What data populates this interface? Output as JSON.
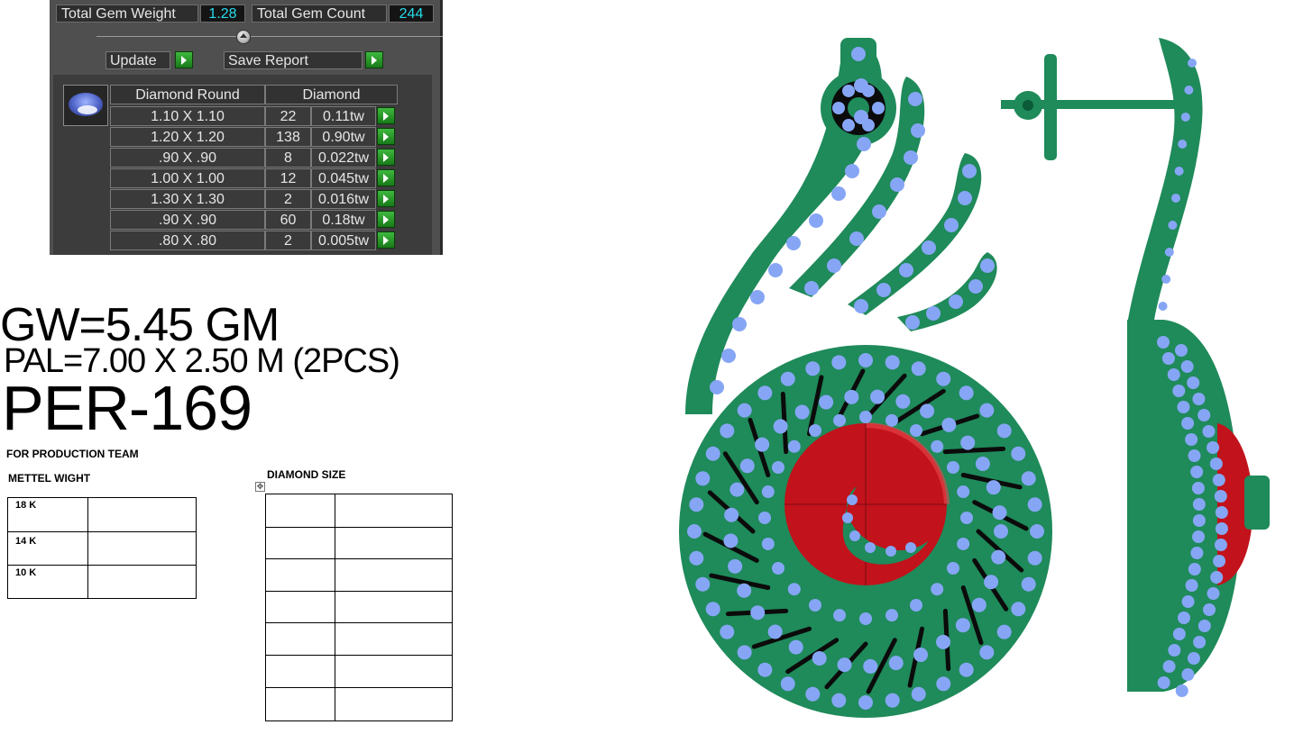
{
  "report": {
    "total_gem_weight_label": "Total Gem Weight",
    "total_gem_weight_value": "1.28",
    "total_gem_count_label": "Total Gem Count",
    "total_gem_count_value": "244",
    "update_label": "Update",
    "save_report_label": "Save Report",
    "columns": [
      "Diamond Round",
      "Diamond"
    ],
    "rows": [
      {
        "size": "1.10 X 1.10",
        "count": "22",
        "weight": "0.11tw"
      },
      {
        "size": "1.20 X 1.20",
        "count": "138",
        "weight": "0.90tw"
      },
      {
        "size": ".90 X .90",
        "count": "8",
        "weight": "0.022tw"
      },
      {
        "size": "1.00 X 1.00",
        "count": "12",
        "weight": "0.045tw"
      },
      {
        "size": "1.30 X 1.30",
        "count": "2",
        "weight": "0.016tw"
      },
      {
        "size": ".90 X .90",
        "count": "60",
        "weight": "0.18tw"
      },
      {
        "size": ".80 X .80",
        "count": "2",
        "weight": "0.005tw"
      }
    ]
  },
  "specs": {
    "gold_weight": "GW=5.45 GM",
    "pal": "PAL=7.00 X 2.50 M (2PCS)",
    "design_code": "PER-169"
  },
  "production": {
    "heading": "FOR PRODUCTION TEAM",
    "metal_weight_heading": "METTEL WIGHT",
    "metal_rows": [
      "18 K",
      "14 K",
      "10 K"
    ],
    "diamond_size_heading": "DIAMOND SIZE"
  },
  "colors": {
    "metal": "#1f8a5a",
    "stone": "#86a6f5",
    "center_stone": "#c2121b"
  }
}
